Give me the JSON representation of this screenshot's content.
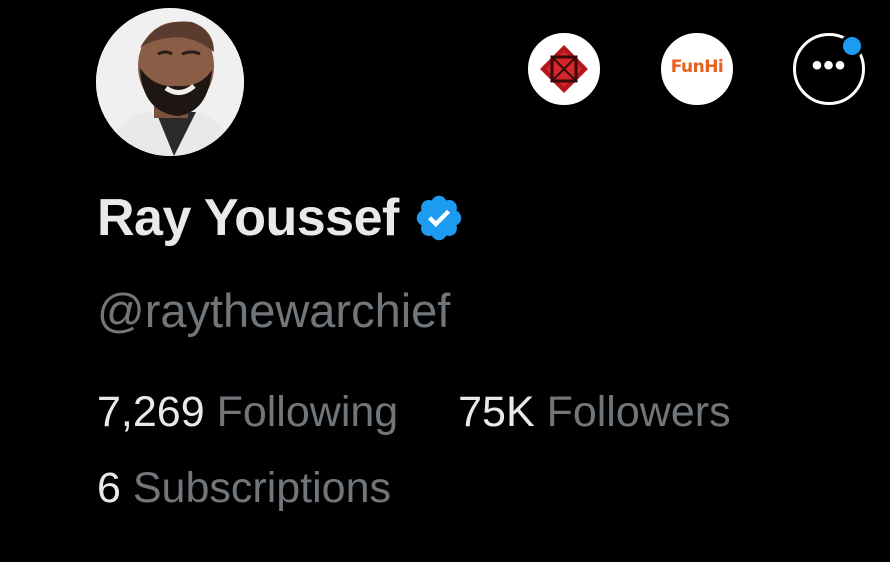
{
  "profile": {
    "display_name": "Ray Youssef",
    "handle": "@raythewarchief",
    "verified": true,
    "avatar_icon": "profile-photo",
    "verified_icon": "verified-badge-icon"
  },
  "header_actions": {
    "subscription_1_icon": "red-geometric-logo-icon",
    "subscription_2_label": "FunHi",
    "more_icon": "more-options-icon",
    "more_label": "•••",
    "notification_dot": true
  },
  "stats": {
    "following_count": "7,269",
    "following_label": "Following",
    "followers_count": "75K",
    "followers_label": "Followers",
    "subscriptions_count": "6",
    "subscriptions_label": "Subscriptions"
  },
  "colors": {
    "background": "#000000",
    "primary_text": "#e7e9ea",
    "secondary_text": "#71767b",
    "accent_blue": "#1d9bf0",
    "funhi_orange": "#e8601c"
  }
}
